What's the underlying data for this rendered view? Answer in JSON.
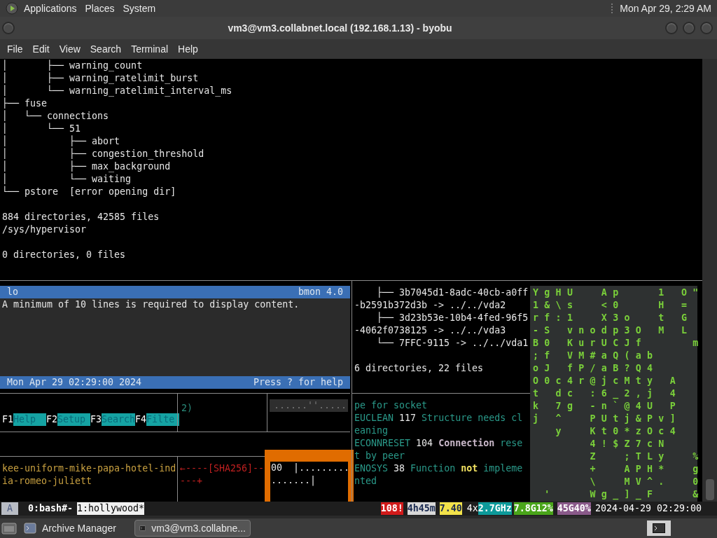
{
  "top_panel": {
    "menus": [
      "Applications",
      "Places",
      "System"
    ],
    "clock": "Mon Apr 29,  2:29 AM"
  },
  "window": {
    "title": "vm3@vm3.collabnet.local (192.168.1.13) - byobu"
  },
  "menu_bar": [
    "File",
    "Edit",
    "View",
    "Search",
    "Terminal",
    "Help"
  ],
  "terminal": {
    "lines": [
      {
        "text": "│       ├── warning_count"
      },
      {
        "text": "│       ├── warning_ratelimit_burst"
      },
      {
        "text": "│       └── warning_ratelimit_interval_ms"
      },
      {
        "text": "├── fuse"
      },
      {
        "text": "│   └── connections"
      },
      {
        "text": "│       └── 51"
      },
      {
        "text": "│           ├── abort"
      },
      {
        "text": "│           ├── congestion_threshold"
      },
      {
        "text": "│           ├── max_background"
      },
      {
        "text": "│           └── waiting"
      },
      {
        "text": "└── pstore  [error opening dir]"
      },
      {
        "text": "884 directories, 42585 files",
        "gap_before": true
      },
      {
        "text": "/sys/hypervisor"
      },
      {
        "text": "0 directories, 0 files",
        "gap_before": true
      }
    ]
  },
  "bmon": {
    "interface": "lo",
    "version": "bmon 4.0",
    "message": "A minimum of 10 lines is required to display content.",
    "datetime": "Mon Apr 29 02:29:00 2024",
    "help_hint": "Press ? for help"
  },
  "function_keys": [
    {
      "key": "F1",
      "label": "Help"
    },
    {
      "key": "F2",
      "label": "Setup"
    },
    {
      "key": "F3",
      "label": "Search"
    },
    {
      "key": "F4",
      "label": "Filte"
    }
  ],
  "pane_fragment": "2)",
  "progress_strip": "......''.....",
  "phrase": "kee-uniform-mike-papa-hotel-india-romeo-juliett",
  "hash_art": [
    "←----[SHA256]--",
    "---+"
  ],
  "hex_box": [
    "00  |.........",
    ".......|"
  ],
  "disk_tree": {
    "lines": [
      {
        "text": "    ├── 3b7045d1-8adc-40cb-a0ff"
      },
      {
        "text": "-b2591b372d3b -> ../../vda2"
      },
      {
        "text": "    ├── 3d23b53e-10b4-4fed-96f5"
      },
      {
        "text": "-4062f0738125 -> ../../vda3"
      },
      {
        "text": "    └── 7FFC-9115 -> ../../vda1"
      },
      {
        "text": "6 directories, 22 files",
        "gap_before": true
      }
    ]
  },
  "errno_list": {
    "continuation": "pe for socket",
    "entries": [
      {
        "name": "EUCLEAN",
        "code": "117",
        "message": "Structure needs cleaning"
      },
      {
        "name": "ECONNRESET",
        "code": "104",
        "message": "**Connection** reset by peer",
        "color": "#c9b8c9"
      },
      {
        "name": "ENOSYS",
        "code": "38",
        "message": "Function **not** implemented",
        "color": "#f0e060"
      }
    ]
  },
  "matrix_rows": [
    "YgHU  Ap   1 O\"",
    "1&\\s  <0   H = ",
    "rf:1  X3o  t G ",
    "-S vnodp3O M L ",
    "B0 KurUCJf    m",
    ";f VM#aQ(ab    ",
    "oJ fP/aB?Q4    ",
    "O0c4r@jcMty A  ",
    "t dc :6_2,j 4  ",
    "k 7g -n`@4U P  ",
    "j ^  PUtj&Pv]  ",
    "  y  Kt0*zOc4  ",
    "     4!$Z7cN   ",
    "     Z  ;TLy  %",
    "     +  APH*  g",
    "     \\  MV^.  0",
    " '   Wg_]_F   &"
  ],
  "status": {
    "session_label": "A",
    "windows": [
      {
        "label": "0:bash#-",
        "selected": false
      },
      {
        "label": "1:hollywood*",
        "selected": true
      }
    ],
    "segments": [
      {
        "text": "108!",
        "color": "#d11a1a"
      },
      {
        "text": "4h45m",
        "color": "#d8d8d8"
      },
      {
        "text": "7.40",
        "color": "#f2e24a"
      },
      {
        "text": "4x"
      },
      {
        "text": "2.7GHz",
        "color": "#0d9a9a"
      },
      {
        "text": "7.8G12%",
        "color": "#4aa51a"
      },
      {
        "text": "45G40%",
        "color": "#8a5a8a"
      },
      {
        "text": "2024-04-29 02:29:00"
      }
    ]
  },
  "taskbar": {
    "items": [
      {
        "label": "Archive Manager",
        "selected": false
      },
      {
        "label": "vm3@vm3.collabne...",
        "selected": true
      }
    ]
  }
}
